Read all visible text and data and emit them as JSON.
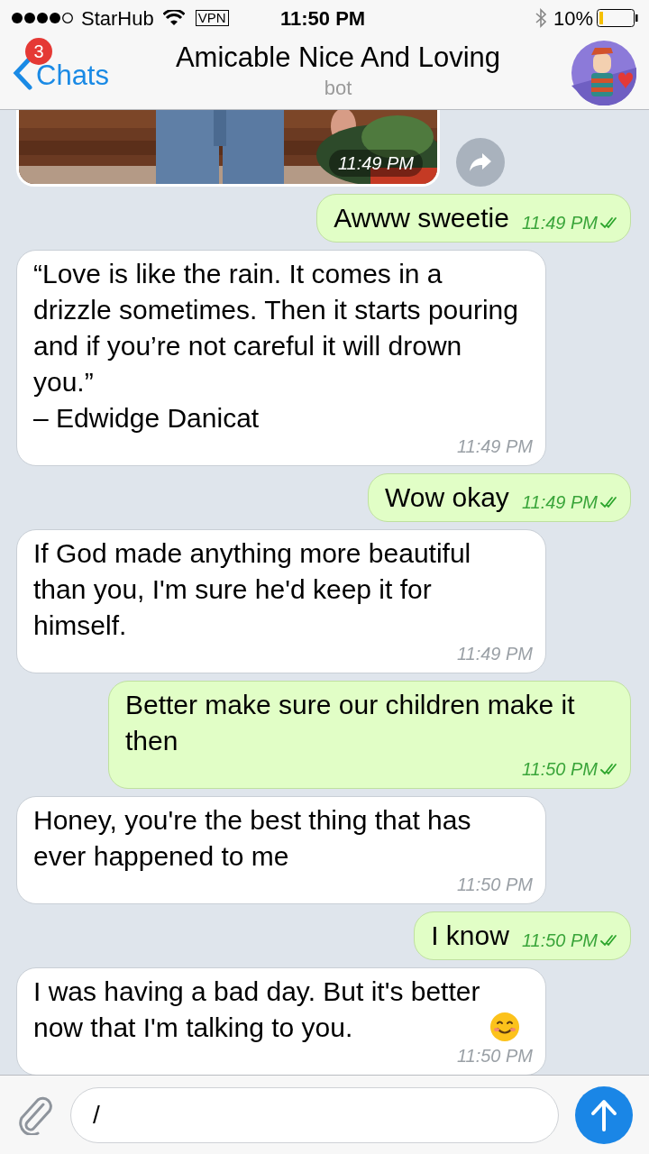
{
  "status_bar": {
    "carrier": "StarHub",
    "vpn": "VPN",
    "time": "11:50 PM",
    "battery": "10%"
  },
  "header": {
    "back_label": "Chats",
    "unread_badge": "3",
    "title": "Amicable Nice And Loving",
    "subtitle": "bot"
  },
  "messages": [
    {
      "kind": "incoming_photo",
      "time": "11:49 PM"
    },
    {
      "kind": "outgoing",
      "text": "Awww sweetie",
      "time": "11:49 PM",
      "read": true
    },
    {
      "kind": "incoming",
      "text": "“Love is like the rain. It comes in a drizzle sometimes. Then it starts pouring and if you’re not careful it will drown you.”\n– Edwidge Danicat",
      "time": "11:49 PM"
    },
    {
      "kind": "outgoing",
      "text": "Wow okay",
      "time": "11:49 PM",
      "read": true
    },
    {
      "kind": "incoming",
      "text": "If God made anything more beautiful than you, I'm sure he'd keep it for himself.",
      "time": "11:49 PM"
    },
    {
      "kind": "outgoing",
      "text": "Better make sure our children make it then",
      "time": "11:50 PM",
      "read": true
    },
    {
      "kind": "incoming",
      "text": "Honey, you're the best thing that has ever happened to me",
      "time": "11:50 PM"
    },
    {
      "kind": "outgoing",
      "text": "I know",
      "time": "11:50 PM",
      "read": true
    },
    {
      "kind": "incoming",
      "text": "I was having a bad day. But it's better now that I'm talking to you.",
      "smiley": true,
      "time": "11:50 PM"
    }
  ],
  "composer": {
    "value": "/"
  }
}
